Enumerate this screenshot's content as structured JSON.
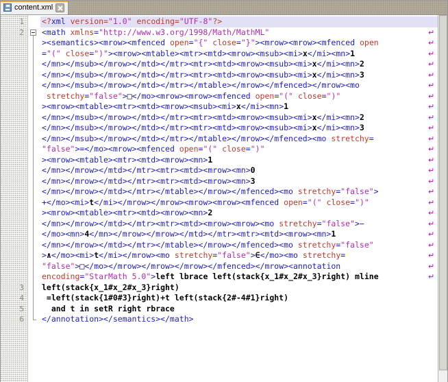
{
  "window": {
    "accent_color": "#f0a030",
    "tab_strip_color": "#d6d2c8"
  },
  "tab": {
    "title": "content.xml",
    "save_icon": "save-disk-icon",
    "close_icon": "close-icon"
  },
  "editor": {
    "highlighted_line": 1,
    "fold_markers": [
      {
        "line": 2,
        "state": "expanded",
        "glyph": "-"
      }
    ],
    "gutter_line_numbers": [
      "1",
      "2",
      "3",
      "4",
      "5",
      "6"
    ],
    "wrap_marker_glyph": "↵",
    "wrap_marker_color": "#cc00cc",
    "visual_rows": [
      {
        "logical_line": "1",
        "wrapped": false,
        "highlight": true,
        "tokens": [
          {
            "t": "pi",
            "s": "<?"
          },
          {
            "t": "pi2",
            "s": "xml"
          },
          {
            "t": "pi",
            "s": " "
          },
          {
            "t": "attr",
            "s": "version"
          },
          {
            "t": "pi",
            "s": "="
          },
          {
            "t": "val",
            "s": "\"1.0\""
          },
          {
            "t": "pi",
            "s": " "
          },
          {
            "t": "attr",
            "s": "encoding"
          },
          {
            "t": "pi",
            "s": "="
          },
          {
            "t": "val",
            "s": "\"UTF-8\""
          },
          {
            "t": "pi",
            "s": "?>"
          }
        ]
      },
      {
        "logical_line": "2",
        "wrapped": true,
        "tokens": [
          {
            "t": "tag",
            "s": "<math "
          },
          {
            "t": "attr",
            "s": "xmlns"
          },
          {
            "t": "tag",
            "s": "="
          },
          {
            "t": "val",
            "s": "\"http://www.w3.org/1998/Math/MathML\""
          }
        ]
      },
      {
        "wrapped": true,
        "tokens": [
          {
            "t": "tag",
            "s": "><semantics><mrow><mfenced "
          },
          {
            "t": "attr",
            "s": "open"
          },
          {
            "t": "tag",
            "s": "="
          },
          {
            "t": "val",
            "s": "\"{\""
          },
          {
            "t": "tag",
            "s": " "
          },
          {
            "t": "attr",
            "s": "close"
          },
          {
            "t": "tag",
            "s": "="
          },
          {
            "t": "val",
            "s": "\"}\""
          },
          {
            "t": "tag",
            "s": "><mrow><mrow><mfenced "
          },
          {
            "t": "attr",
            "s": "open"
          }
        ]
      },
      {
        "wrapped": true,
        "tokens": [
          {
            "t": "tag",
            "s": "="
          },
          {
            "t": "val",
            "s": "\"(\""
          },
          {
            "t": "tag",
            "s": " "
          },
          {
            "t": "attr",
            "s": "close"
          },
          {
            "t": "tag",
            "s": "="
          },
          {
            "t": "val",
            "s": "\")\""
          },
          {
            "t": "tag",
            "s": "><mrow><mtable><mtr><mtd><mrow><msub><mi>"
          },
          {
            "t": "txt",
            "s": "x"
          },
          {
            "t": "tag",
            "s": "</mi><mn>"
          },
          {
            "t": "txt",
            "s": "1"
          }
        ]
      },
      {
        "wrapped": true,
        "tokens": [
          {
            "t": "tag",
            "s": "</mn></msub></mrow></mtd></mtr><mtr><mtd><mrow><msub><mi>"
          },
          {
            "t": "txt",
            "s": "x"
          },
          {
            "t": "tag",
            "s": "</mi><mn>"
          },
          {
            "t": "txt",
            "s": "2"
          }
        ]
      },
      {
        "wrapped": true,
        "tokens": [
          {
            "t": "tag",
            "s": "</mn></msub></mrow></mtd></mtr><mtr><mtd><mrow><msub><mi>"
          },
          {
            "t": "txt",
            "s": "x"
          },
          {
            "t": "tag",
            "s": "</mi><mn>"
          },
          {
            "t": "txt",
            "s": "3"
          }
        ]
      },
      {
        "wrapped": true,
        "tokens": [
          {
            "t": "tag",
            "s": "</mn></msub></mrow></mtd></mtr></mtable></mrow></mfenced></mrow><mo"
          }
        ]
      },
      {
        "wrapped": true,
        "tokens": [
          {
            "t": "attr",
            "s": " stretchy"
          },
          {
            "t": "tag",
            "s": "="
          },
          {
            "t": "val",
            "s": "\"false\""
          },
          {
            "t": "tag",
            "s": ">"
          },
          {
            "t": "txt",
            "s": "□"
          },
          {
            "t": "tag",
            "s": "</mo><mrow><mrow><mfenced "
          },
          {
            "t": "attr",
            "s": "open"
          },
          {
            "t": "tag",
            "s": "="
          },
          {
            "t": "val",
            "s": "\"(\""
          },
          {
            "t": "tag",
            "s": " "
          },
          {
            "t": "attr",
            "s": "close"
          },
          {
            "t": "tag",
            "s": "="
          },
          {
            "t": "val",
            "s": "\")\""
          }
        ]
      },
      {
        "wrapped": true,
        "tokens": [
          {
            "t": "tag",
            "s": "><mrow><mtable><mtr><mtd><mrow><msub><mi>"
          },
          {
            "t": "txt",
            "s": "x"
          },
          {
            "t": "tag",
            "s": "</mi><mn>"
          },
          {
            "t": "txt",
            "s": "1"
          }
        ]
      },
      {
        "wrapped": true,
        "tokens": [
          {
            "t": "tag",
            "s": "</mn></msub></mrow></mtd></mtr><mtr><mtd><mrow><msub><mi>"
          },
          {
            "t": "txt",
            "s": "x"
          },
          {
            "t": "tag",
            "s": "</mi><mn>"
          },
          {
            "t": "txt",
            "s": "2"
          }
        ]
      },
      {
        "wrapped": true,
        "tokens": [
          {
            "t": "tag",
            "s": "</mn></msub></mrow></mtd></mtr><mtr><mtd><mrow><msub><mi>"
          },
          {
            "t": "txt",
            "s": "x"
          },
          {
            "t": "tag",
            "s": "</mi><mn>"
          },
          {
            "t": "txt",
            "s": "3"
          }
        ]
      },
      {
        "wrapped": true,
        "tokens": [
          {
            "t": "tag",
            "s": "</mn></msub></mrow></mtd></mtr></mtable></mrow></mfenced><mo "
          },
          {
            "t": "attr",
            "s": "stretchy"
          },
          {
            "t": "tag",
            "s": "="
          }
        ]
      },
      {
        "wrapped": true,
        "tokens": [
          {
            "t": "val",
            "s": "\"false\""
          },
          {
            "t": "tag",
            "s": ">=</mo><mrow><mfenced "
          },
          {
            "t": "attr",
            "s": "open"
          },
          {
            "t": "tag",
            "s": "="
          },
          {
            "t": "val",
            "s": "\"(\""
          },
          {
            "t": "tag",
            "s": " "
          },
          {
            "t": "attr",
            "s": "close"
          },
          {
            "t": "tag",
            "s": "="
          },
          {
            "t": "val",
            "s": "\")\""
          }
        ]
      },
      {
        "wrapped": true,
        "tokens": [
          {
            "t": "tag",
            "s": "><mrow><mtable><mtr><mtd><mrow><mn>"
          },
          {
            "t": "txt",
            "s": "1"
          }
        ]
      },
      {
        "wrapped": true,
        "tokens": [
          {
            "t": "tag",
            "s": "</mn></mrow></mtd></mtr><mtr><mtd><mrow><mn>"
          },
          {
            "t": "txt",
            "s": "0"
          }
        ]
      },
      {
        "wrapped": true,
        "tokens": [
          {
            "t": "tag",
            "s": "</mn></mrow></mtd></mtr><mtr><mtd><mrow><mn>"
          },
          {
            "t": "txt",
            "s": "3"
          }
        ]
      },
      {
        "wrapped": true,
        "tokens": [
          {
            "t": "tag",
            "s": "</mn></mrow></mtd></mtr></mtable></mrow></mfenced><mo "
          },
          {
            "t": "attr",
            "s": "stretchy"
          },
          {
            "t": "tag",
            "s": "="
          },
          {
            "t": "val",
            "s": "\"false\""
          },
          {
            "t": "tag",
            "s": ">"
          }
        ]
      },
      {
        "wrapped": true,
        "tokens": [
          {
            "t": "tag",
            "s": "+</mo><mi>"
          },
          {
            "t": "txt",
            "s": "t"
          },
          {
            "t": "tag",
            "s": "</mi></mrow></mrow><mrow><mrow><mfenced "
          },
          {
            "t": "attr",
            "s": "open"
          },
          {
            "t": "tag",
            "s": "="
          },
          {
            "t": "val",
            "s": "\"(\""
          },
          {
            "t": "tag",
            "s": " "
          },
          {
            "t": "attr",
            "s": "close"
          },
          {
            "t": "tag",
            "s": "="
          },
          {
            "t": "val",
            "s": "\")\""
          }
        ]
      },
      {
        "wrapped": true,
        "tokens": [
          {
            "t": "tag",
            "s": "><mrow><mtable><mtr><mtd><mrow><mn>"
          },
          {
            "t": "txt",
            "s": "2"
          }
        ]
      },
      {
        "wrapped": true,
        "tokens": [
          {
            "t": "tag",
            "s": "</mn></mrow></mtd></mtr><mtr><mtd><mrow><mrow><mo "
          },
          {
            "t": "attr",
            "s": "stretchy"
          },
          {
            "t": "tag",
            "s": "="
          },
          {
            "t": "val",
            "s": "\"false\""
          },
          {
            "t": "tag",
            "s": ">−"
          }
        ]
      },
      {
        "wrapped": true,
        "tokens": [
          {
            "t": "tag",
            "s": "</mo><mn>"
          },
          {
            "t": "txt",
            "s": "4"
          },
          {
            "t": "tag",
            "s": "</mn></mrow></mrow></mtd></mtr><mtr><mtd><mrow><mn>"
          },
          {
            "t": "txt",
            "s": "1"
          }
        ]
      },
      {
        "wrapped": true,
        "tokens": [
          {
            "t": "tag",
            "s": "</mn></mrow></mtd></mtr></mtable></mrow></mfenced><mo "
          },
          {
            "t": "attr",
            "s": "stretchy"
          },
          {
            "t": "tag",
            "s": "="
          },
          {
            "t": "val",
            "s": "\"false\""
          }
        ]
      },
      {
        "wrapped": true,
        "tokens": [
          {
            "t": "tag",
            "s": ">"
          },
          {
            "t": "txt",
            "s": "∧"
          },
          {
            "t": "tag",
            "s": "</mo><mi>"
          },
          {
            "t": "txt",
            "s": "t"
          },
          {
            "t": "tag",
            "s": "</mi></mrow><mo "
          },
          {
            "t": "attr",
            "s": "stretchy"
          },
          {
            "t": "tag",
            "s": "="
          },
          {
            "t": "val",
            "s": "\"false\""
          },
          {
            "t": "tag",
            "s": ">"
          },
          {
            "t": "txt",
            "s": "∈"
          },
          {
            "t": "tag",
            "s": "</mo><mo "
          },
          {
            "t": "attr",
            "s": "stretchy"
          },
          {
            "t": "tag",
            "s": "="
          }
        ]
      },
      {
        "wrapped": true,
        "tokens": [
          {
            "t": "val",
            "s": "\"false\""
          },
          {
            "t": "tag",
            "s": ">"
          },
          {
            "t": "txt",
            "s": "□"
          },
          {
            "t": "tag",
            "s": "</mo></mrow></mrow></mrow></mfenced></mrow><annotation"
          }
        ]
      },
      {
        "wrapped": true,
        "tokens": [
          {
            "t": "attr",
            "s": "encoding"
          },
          {
            "t": "tag",
            "s": "="
          },
          {
            "t": "val",
            "s": "\"StarMath 5.0\""
          },
          {
            "t": "tag",
            "s": ">"
          },
          {
            "t": "txt",
            "s": "left lbrace left(stack{x_1#x_2#x_3}right) mline"
          }
        ]
      },
      {
        "logical_line": "3",
        "wrapped": false,
        "tokens": [
          {
            "t": "txt",
            "s": "left(stack{x_1#x_2#x_3}right)"
          }
        ]
      },
      {
        "logical_line": "4",
        "wrapped": false,
        "tokens": [
          {
            "t": "txt",
            "s": " =left(stack{1#0#3}right)+t left(stack{2#-4#1}right)"
          }
        ]
      },
      {
        "logical_line": "5",
        "wrapped": false,
        "tokens": [
          {
            "t": "txt",
            "s": "  and t in setR right rbrace"
          }
        ]
      },
      {
        "logical_line": "6",
        "wrapped": false,
        "tokens": [
          {
            "t": "tag",
            "s": "</annotation></semantics></math>"
          }
        ]
      }
    ]
  },
  "scrollbar": {
    "orientation": "vertical",
    "thumb_position_percent": 0
  }
}
